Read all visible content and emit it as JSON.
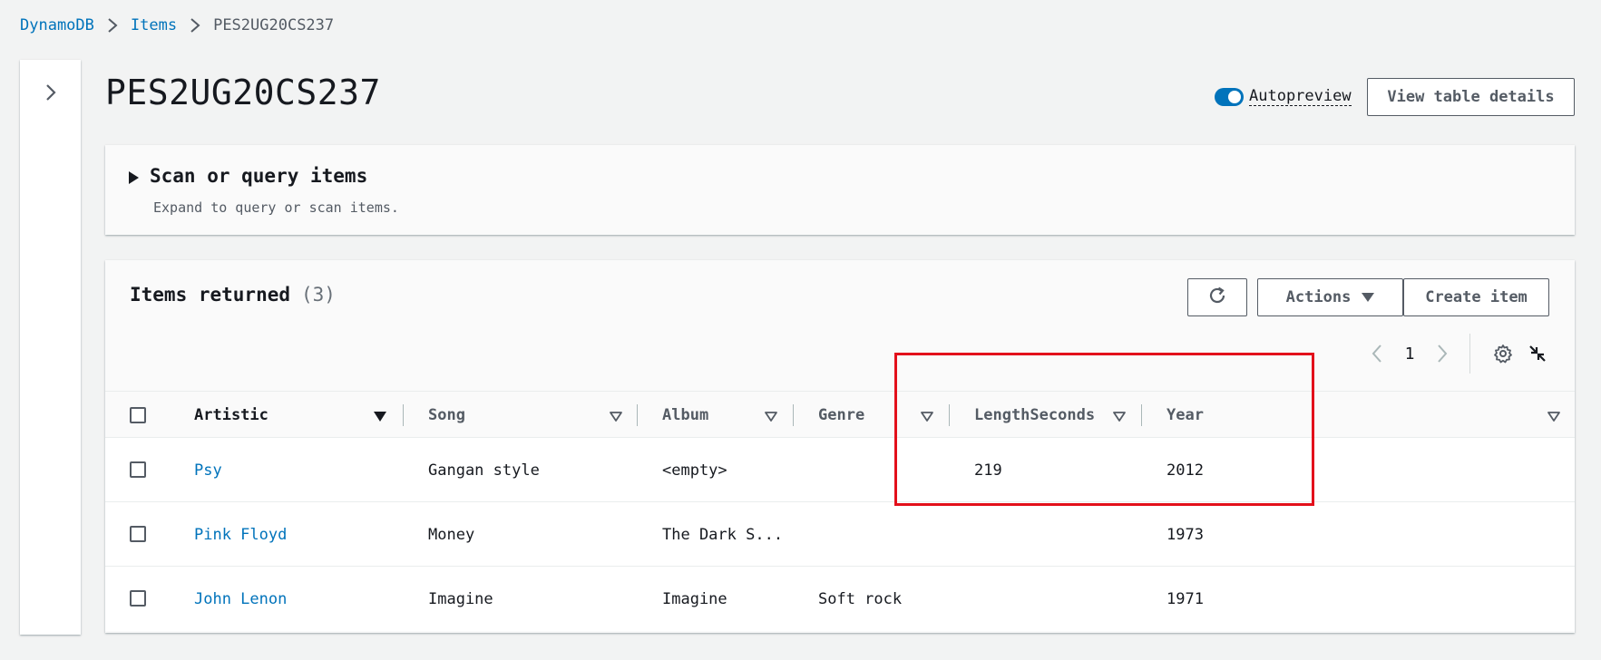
{
  "breadcrumb": {
    "items": [
      {
        "label": "DynamoDB"
      },
      {
        "label": "Items"
      },
      {
        "label": "PES2UG20CS237"
      }
    ]
  },
  "page": {
    "title": "PES2UG20CS237"
  },
  "autopreview": {
    "label": "Autopreview",
    "enabled": true
  },
  "header_buttons": {
    "view_table_details": "View table details"
  },
  "scan_panel": {
    "title": "Scan or query items",
    "description": "Expand to query or scan items."
  },
  "items_panel": {
    "title": "Items returned",
    "count": "(3)",
    "actions_label": "Actions",
    "create_label": "Create item",
    "page_number": "1"
  },
  "table": {
    "columns": [
      {
        "label": "Artistic",
        "sorted": true
      },
      {
        "label": "Song"
      },
      {
        "label": "Album"
      },
      {
        "label": "Genre"
      },
      {
        "label": "LengthSeconds"
      },
      {
        "label": "Year"
      }
    ],
    "rows": [
      {
        "artistic": "Psy",
        "song": "Gangan style",
        "album": "<empty>",
        "genre": "",
        "length": "219",
        "year": "2012"
      },
      {
        "artistic": "Pink Floyd",
        "song": "Money",
        "album": "The Dark S...",
        "genre": "",
        "length": "",
        "year": "1973"
      },
      {
        "artistic": "John Lenon",
        "song": "Imagine",
        "album": "Imagine",
        "genre": "Soft rock",
        "length": "",
        "year": "1971"
      }
    ]
  },
  "colors": {
    "link": "#0073bb",
    "highlight": "#e3101b",
    "background": "#f2f3f3"
  }
}
